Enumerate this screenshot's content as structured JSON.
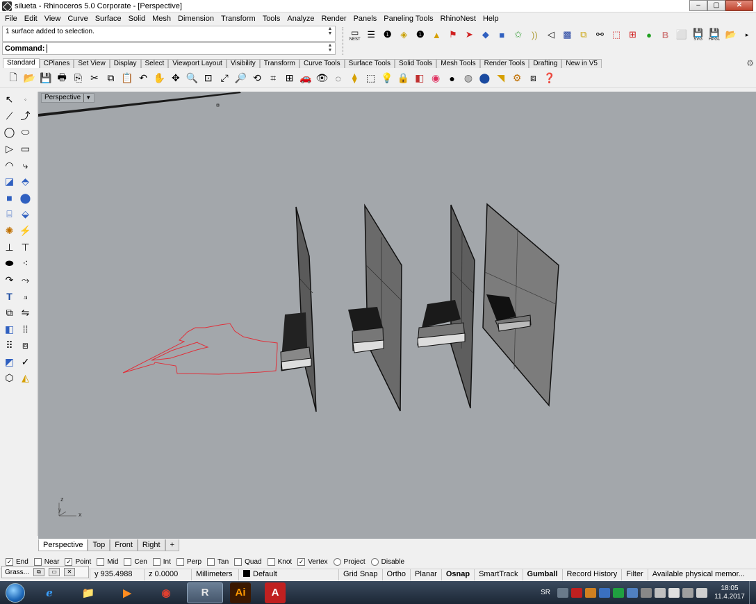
{
  "window": {
    "title": "silueta - Rhinoceros  5.0 Corporate - [Perspective]",
    "controls": [
      "–",
      "▢",
      "✕"
    ]
  },
  "menu": [
    "File",
    "Edit",
    "View",
    "Curve",
    "Surface",
    "Solid",
    "Mesh",
    "Dimension",
    "Transform",
    "Tools",
    "Analyze",
    "Render",
    "Panels",
    "Paneling Tools",
    "RhinoNest",
    "Help"
  ],
  "command": {
    "history": "1 surface added to selection.",
    "prompt": "Command:"
  },
  "plugin_toolbar": {
    "nest_label": "NEST",
    "svg_label": "SVG",
    "hpgl_label": "HPGL"
  },
  "tabs": [
    "Standard",
    "CPlanes",
    "Set View",
    "Display",
    "Select",
    "Viewport Layout",
    "Visibility",
    "Transform",
    "Curve Tools",
    "Surface Tools",
    "Solid Tools",
    "Mesh Tools",
    "Render Tools",
    "Drafting",
    "New in V5"
  ],
  "active_tab": "Standard",
  "viewport": {
    "name": "Perspective",
    "axis_x": "x",
    "axis_y": "y",
    "axis_z": "z"
  },
  "viewport_tabs": [
    "Perspective",
    "Top",
    "Front",
    "Right"
  ],
  "viewport_add": "+",
  "osnaps": [
    {
      "label": "End",
      "checked": true
    },
    {
      "label": "Near",
      "checked": false
    },
    {
      "label": "Point",
      "checked": true
    },
    {
      "label": "Mid",
      "checked": false
    },
    {
      "label": "Cen",
      "checked": false
    },
    {
      "label": "Int",
      "checked": false
    },
    {
      "label": "Perp",
      "checked": false
    },
    {
      "label": "Tan",
      "checked": false
    },
    {
      "label": "Quad",
      "checked": false
    },
    {
      "label": "Knot",
      "checked": false
    },
    {
      "label": "Vertex",
      "checked": true
    },
    {
      "label": "Project",
      "checked": false
    },
    {
      "label": "Disable",
      "checked": false
    }
  ],
  "status": {
    "y": "y 935.4988",
    "z": "z 0.0000",
    "units": "Millimeters",
    "layer": "Default",
    "grid_snap": "Grid Snap",
    "ortho": "Ortho",
    "planar": "Planar",
    "osnap": "Osnap",
    "smarttrack": "SmartTrack",
    "gumball": "Gumball",
    "record_history": "Record History",
    "filter": "Filter",
    "memory": "Available physical memor..."
  },
  "grasshopper": {
    "label": "Grass...",
    "buttons": [
      "⧉",
      "▭",
      "✕"
    ]
  },
  "taskbar": {
    "apps": [
      "e",
      "📁",
      "▶",
      "◉",
      "R",
      "Ai",
      "A"
    ],
    "tray_lang": "SR",
    "time": "18:05",
    "date": "11.4.2017"
  },
  "colors": {
    "viewport_bg": "#a3a7ab",
    "curve_red": "#e0303a",
    "active_tab_bg": "#ffffff"
  }
}
